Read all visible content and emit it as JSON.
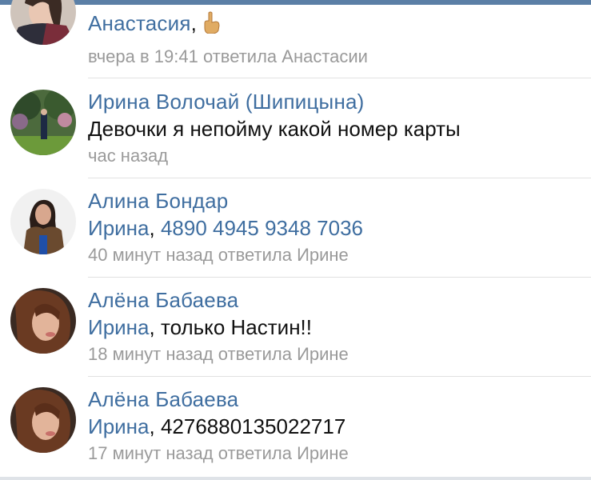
{
  "comments": [
    {
      "author": "Анастасия",
      "text_suffix": ",",
      "emoji": "pointing-up-hand-emoji",
      "meta": "вчера в 19:41 ответила Анастасии"
    },
    {
      "author": "Ирина Волочай (Шипицына)",
      "text": "Девочки я непойму какой номер карты",
      "meta": "час назад"
    },
    {
      "author": "Алина Бондар",
      "mention": "Ирина",
      "sep": ", ",
      "text": "4890 4945 9348 7036",
      "meta": "40 минут назад ответила Ирине"
    },
    {
      "author": "Алёна Бабаева",
      "mention": "Ирина",
      "sep": ", ",
      "text": "только Настин!!",
      "meta": "18 минут назад ответила Ирине"
    },
    {
      "author": "Алёна Бабаева",
      "mention": "Ирина",
      "sep": ", ",
      "text": "4276880135022717",
      "meta": "17 минут назад ответила Ирине"
    }
  ],
  "colors": {
    "accent": "#3f6ea0",
    "text": "#111111",
    "meta": "#9a9a9a",
    "topbar": "#5b7fa6"
  }
}
